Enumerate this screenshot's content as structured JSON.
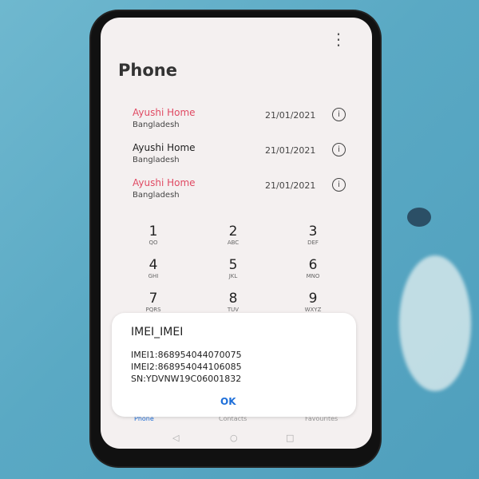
{
  "app": {
    "title": "Phone",
    "menu_icon": "more-vert-icon"
  },
  "calls": [
    {
      "name": "Ayushi Home",
      "location": "Bangladesh",
      "date": "21/01/2021",
      "name_color": "#e04a63"
    },
    {
      "name": "Ayushi Home",
      "location": "Bangladesh",
      "date": "21/01/2021",
      "name_color": "#222222"
    },
    {
      "name": "Ayushi Home",
      "location": "Bangladesh",
      "date": "21/01/2021",
      "name_color": "#e04a63"
    }
  ],
  "keypad": [
    {
      "digit": "1",
      "letters": "QO"
    },
    {
      "digit": "2",
      "letters": "ABC"
    },
    {
      "digit": "3",
      "letters": "DEF"
    },
    {
      "digit": "4",
      "letters": "GHI"
    },
    {
      "digit": "5",
      "letters": "JKL"
    },
    {
      "digit": "6",
      "letters": "MNO"
    },
    {
      "digit": "7",
      "letters": "PQRS"
    },
    {
      "digit": "8",
      "letters": "TUV"
    },
    {
      "digit": "9",
      "letters": "WXYZ"
    }
  ],
  "dialog": {
    "title": "IMEI_IMEI",
    "imei1": "IMEI1:868954044070075",
    "imei2": "IMEI2:868954044106085",
    "sn": "SN:YDVNW19C06001832",
    "ok_label": "OK"
  },
  "tabs": [
    "Phone",
    "Contacts",
    "Favourites"
  ],
  "colors": {
    "accent": "#1e6fd9",
    "missed": "#e04a63"
  }
}
